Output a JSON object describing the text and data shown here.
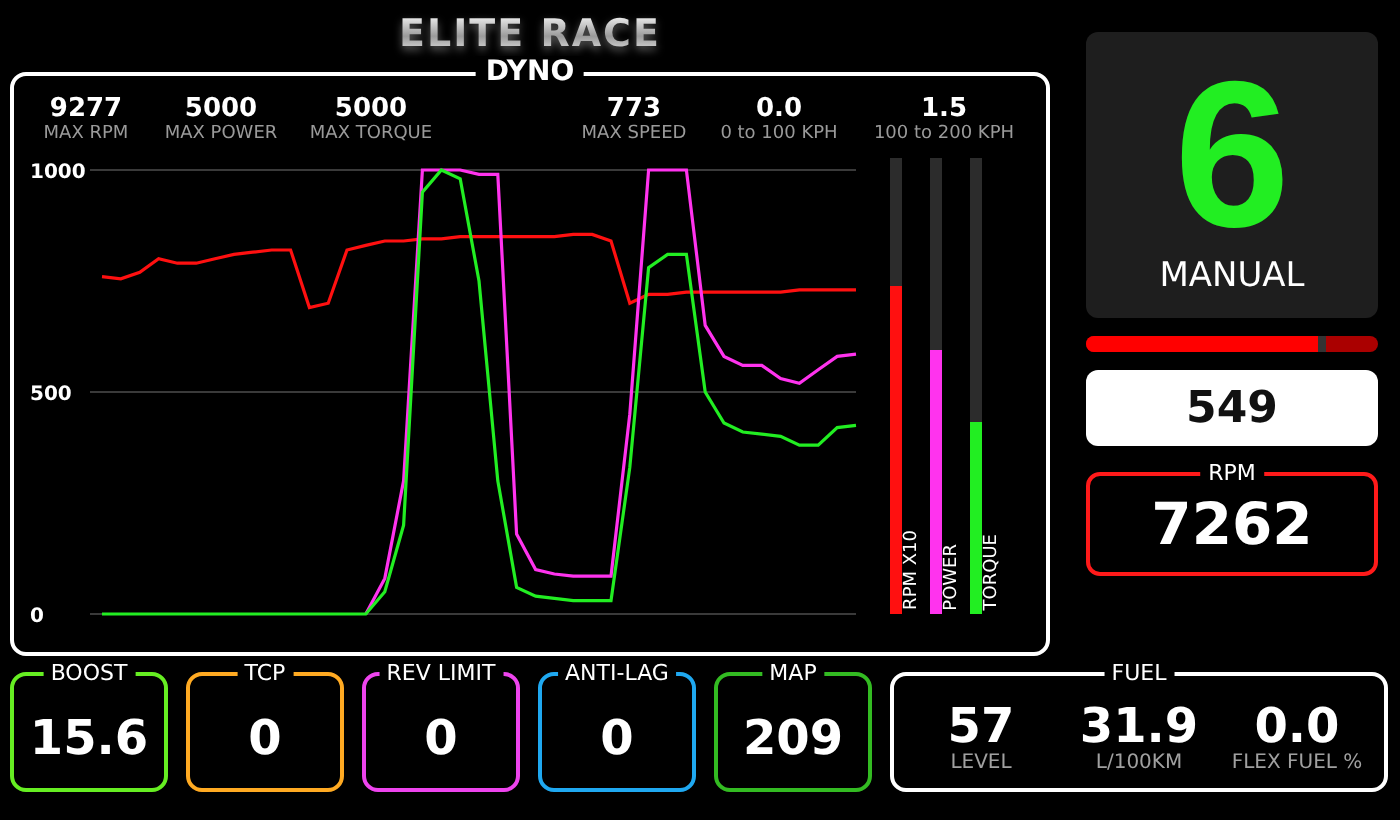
{
  "title": "ELITE RACE",
  "dyno": {
    "title": "DYNO",
    "stats": [
      {
        "value": "9277",
        "label": "MAX RPM"
      },
      {
        "value": "5000",
        "label": "MAX POWER"
      },
      {
        "value": "5000",
        "label": "MAX TORQUE"
      },
      {
        "value": "773",
        "label": "MAX SPEED"
      },
      {
        "value": "0.0",
        "label": "0 to 100 KPH"
      },
      {
        "value": "1.5",
        "label": "100 to 200 KPH"
      }
    ],
    "chart_data": {
      "type": "line",
      "ylim": [
        0,
        1000
      ],
      "yticks": [
        0,
        500,
        1000
      ],
      "series": [
        {
          "name": "RPM X10",
          "color": "#ff1010",
          "values": [
            760,
            755,
            770,
            800,
            790,
            790,
            800,
            810,
            815,
            820,
            820,
            690,
            700,
            820,
            830,
            840,
            840,
            845,
            845,
            850,
            850,
            850,
            850,
            850,
            850,
            855,
            855,
            840,
            700,
            720,
            720,
            725,
            725,
            725,
            725,
            725,
            725,
            730,
            730,
            730,
            730
          ]
        },
        {
          "name": "POWER",
          "color": "#ff33ee",
          "values": [
            null,
            null,
            null,
            null,
            null,
            null,
            null,
            null,
            null,
            null,
            null,
            null,
            null,
            null,
            0,
            80,
            300,
            1000,
            1000,
            1000,
            990,
            990,
            180,
            100,
            90,
            85,
            85,
            85,
            450,
            1000,
            1000,
            1000,
            650,
            580,
            560,
            560,
            530,
            520,
            550,
            580,
            585
          ]
        },
        {
          "name": "TORQUE",
          "color": "#22ee22",
          "values": [
            0,
            0,
            0,
            0,
            0,
            0,
            0,
            0,
            0,
            0,
            0,
            0,
            0,
            0,
            0,
            50,
            200,
            950,
            1000,
            980,
            750,
            300,
            60,
            40,
            35,
            30,
            30,
            30,
            330,
            780,
            810,
            810,
            500,
            430,
            410,
            405,
            400,
            380,
            380,
            420,
            425
          ]
        }
      ]
    },
    "meters": [
      {
        "level": 0.72
      },
      {
        "level": 0.58
      },
      {
        "level": 0.42
      }
    ]
  },
  "gear": {
    "value": "6",
    "mode": "MANUAL"
  },
  "shift_bar": {
    "level": 0.82
  },
  "speed": "549",
  "rpm": {
    "label": "RPM",
    "value": "7262"
  },
  "gauges": [
    {
      "label": "BOOST",
      "value": "15.6",
      "color": "#66ee22"
    },
    {
      "label": "TCP",
      "value": "0",
      "color": "#ffaa22"
    },
    {
      "label": "REV LIMIT",
      "value": "0",
      "color": "#ee44ee"
    },
    {
      "label": "ANTI-LAG",
      "value": "0",
      "color": "#1fa8f0"
    },
    {
      "label": "MAP",
      "value": "209",
      "color": "#33bb22"
    }
  ],
  "fuel": {
    "label": "FUEL",
    "items": [
      {
        "value": "57",
        "label": "LEVEL"
      },
      {
        "value": "31.9",
        "label": "L/100KM"
      },
      {
        "value": "0.0",
        "label": "FLEX FUEL %"
      }
    ]
  }
}
